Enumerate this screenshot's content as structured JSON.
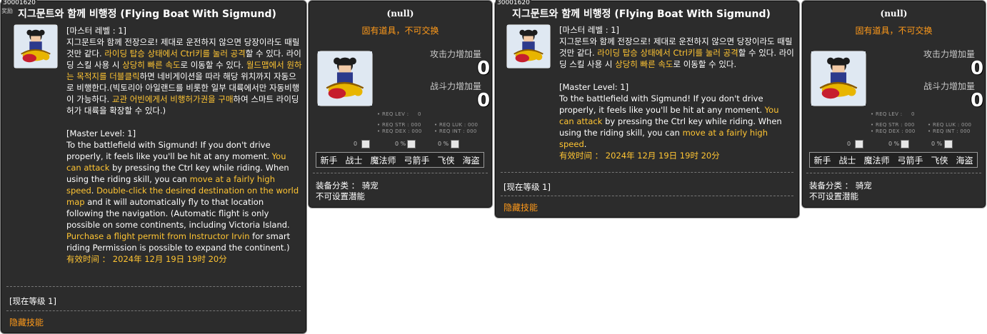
{
  "item_id": "30001620",
  "item_id_small": "30001620",
  "title": "지그문트와 함께 비행정 (Flying Boat With Sigmund)",
  "desc_kr": {
    "level": "[마스터 레벨 : 1]",
    "p1": "지그문트와 함께 전장으로! 제대로 운전하지 않으면 당장이라도 때릴 것만 같다. ",
    "h1": "라이딩 탑승 상태에서 Ctrl키를 눌러 공격",
    "p2": "할 수 있다. 라이딩 스킬 사용 시 ",
    "h2": "상당히 빠른 속도",
    "p3": "로 이동할 수 있다. ",
    "h3": "월드맵에서 원하는 목적지를 더블클릭",
    "p4": "하면 네비게이션을 따라 해당 위치까지 자동으로 비행한다.(빅토리아 아일랜드를 비롯한 일부 대륙에서만 자동비행이 가능하다. ",
    "h4": "교관 어빈에게서 비행허가권을 구매",
    "p5": "하여 스마트 라이딩 허가 대륙을 확장할 수 있다.)"
  },
  "desc_en": {
    "level": "[Master Level: 1]",
    "p1": "To the battlefield with Sigmund! If you don't drive properly, it feels like you'll be hit at any moment. ",
    "h1": "You can attack",
    "p2": " by pressing the Ctrl key while riding. When using the riding skill, you can  ",
    "h2": "move at a fairly high speed",
    "p3": ".  ",
    "h3": "Double-click the desired destination on the world map",
    "p4": " and it will automatically fly to that location following the navigation. (Automatic flight is only possible on some continents, including Victoria Island. ",
    "h4": "Purchase a flight permit from Instructor Irvin",
    "p5": " for smart riding Permission is possible to expand the continent.)"
  },
  "desc_en_short": {
    "level": "[Master Level: 1]",
    "p1": "To the battlefield with Sigmund! If you don't drive properly, it feels like you'll be hit at any moment. ",
    "h1": "You can attack",
    "p2": " by pressing the Ctrl key while riding. When using the riding skill, you can  ",
    "h2": "move at a fairly high speed",
    "p3": "."
  },
  "expiry": "有效时间 ： 2024年 12月 19日 19时 20分",
  "current_level": "[现在等级 1]",
  "hidden_skill": "隐藏技能",
  "equip": {
    "name": "(null)",
    "untradable": "固有道具，不可交换",
    "atk_label": "攻击力增加量",
    "atk_value": "0",
    "power_label": "战斗力增加量",
    "power_value": "0",
    "req_lev": "• REQ LEV :",
    "req_lev_val": "0",
    "req_str": "• REQ STR : 000",
    "req_luk": "• REQ LUK : 000",
    "req_dex": "• REQ DEX : 000",
    "req_int": "• REQ INT : 000",
    "opt1": "0",
    "opt2": "0 %",
    "opt3": "0 %",
    "jobs": [
      "新手",
      "战士",
      "魔法师",
      "弓箭手",
      "飞侠",
      "海盗"
    ],
    "category": "装备分类 ： 骑宠",
    "no_potential": "不可设置潜能"
  },
  "colors": {
    "panel_bg": "#2c2c2c",
    "highlight": "#ffc533",
    "orange": "#ff9a1a"
  }
}
